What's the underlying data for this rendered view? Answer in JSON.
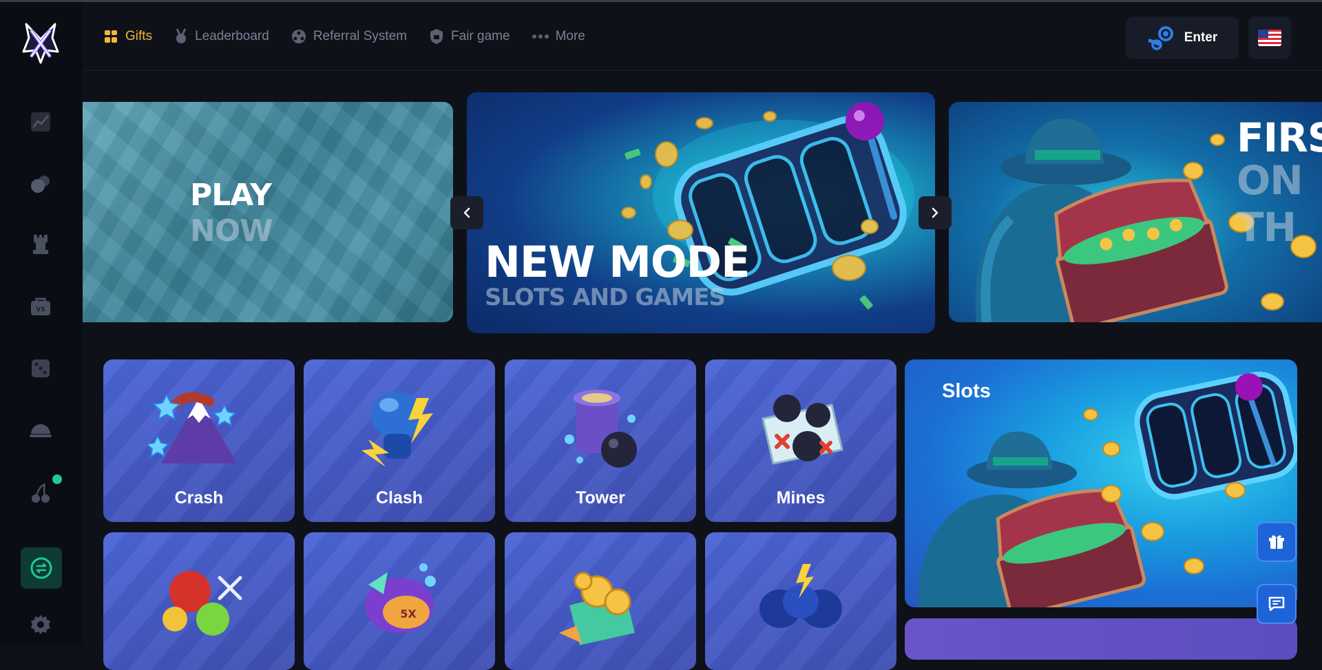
{
  "header": {
    "nav": [
      {
        "label": "Gifts",
        "icon": "gift-icon",
        "active": true
      },
      {
        "label": "Leaderboard",
        "icon": "medal-icon",
        "active": false
      },
      {
        "label": "Referral System",
        "icon": "referral-icon",
        "active": false
      },
      {
        "label": "Fair game",
        "icon": "shield-icon",
        "active": false
      },
      {
        "label": "More",
        "icon": "dots-icon",
        "active": false
      }
    ],
    "enter_label": "Enter",
    "enter_icon": "steam-icon",
    "language_icon": "us-flag-icon"
  },
  "sidebar": {
    "items": [
      {
        "icon": "crash-chart-icon"
      },
      {
        "icon": "clash-balls-icon"
      },
      {
        "icon": "tower-rook-icon"
      },
      {
        "icon": "versus-bag-icon"
      },
      {
        "icon": "dice-icon"
      },
      {
        "icon": "bowl-icon"
      },
      {
        "icon": "cherry-icon",
        "has_indicator": true
      },
      {
        "icon": "exchange-icon",
        "active": true
      },
      {
        "icon": "settings-gear-icon"
      }
    ]
  },
  "carousel": {
    "slides": [
      {
        "title": "PLAY",
        "subtitle": "NOW"
      },
      {
        "title": "NEW MODE",
        "subtitle": "SLOTS AND GAMES"
      },
      {
        "title": "FIRST",
        "subtitle": "ON TH"
      }
    ],
    "prev_icon": "chevron-left-icon",
    "next_icon": "chevron-right-icon"
  },
  "games": [
    {
      "label": "Crash"
    },
    {
      "label": "Clash"
    },
    {
      "label": "Tower"
    },
    {
      "label": "Mines"
    },
    {
      "label": ""
    },
    {
      "label": ""
    },
    {
      "label": ""
    },
    {
      "label": ""
    }
  ],
  "slots": {
    "label": "Slots"
  },
  "floating": {
    "gift_icon": "gift-icon",
    "chat_icon": "chat-icon"
  },
  "colors": {
    "accent": "#f2b73a",
    "background": "#0f1119",
    "sidebar": "#0b0d14",
    "tile": "#4559c4",
    "active_green": "#1ec99a"
  }
}
